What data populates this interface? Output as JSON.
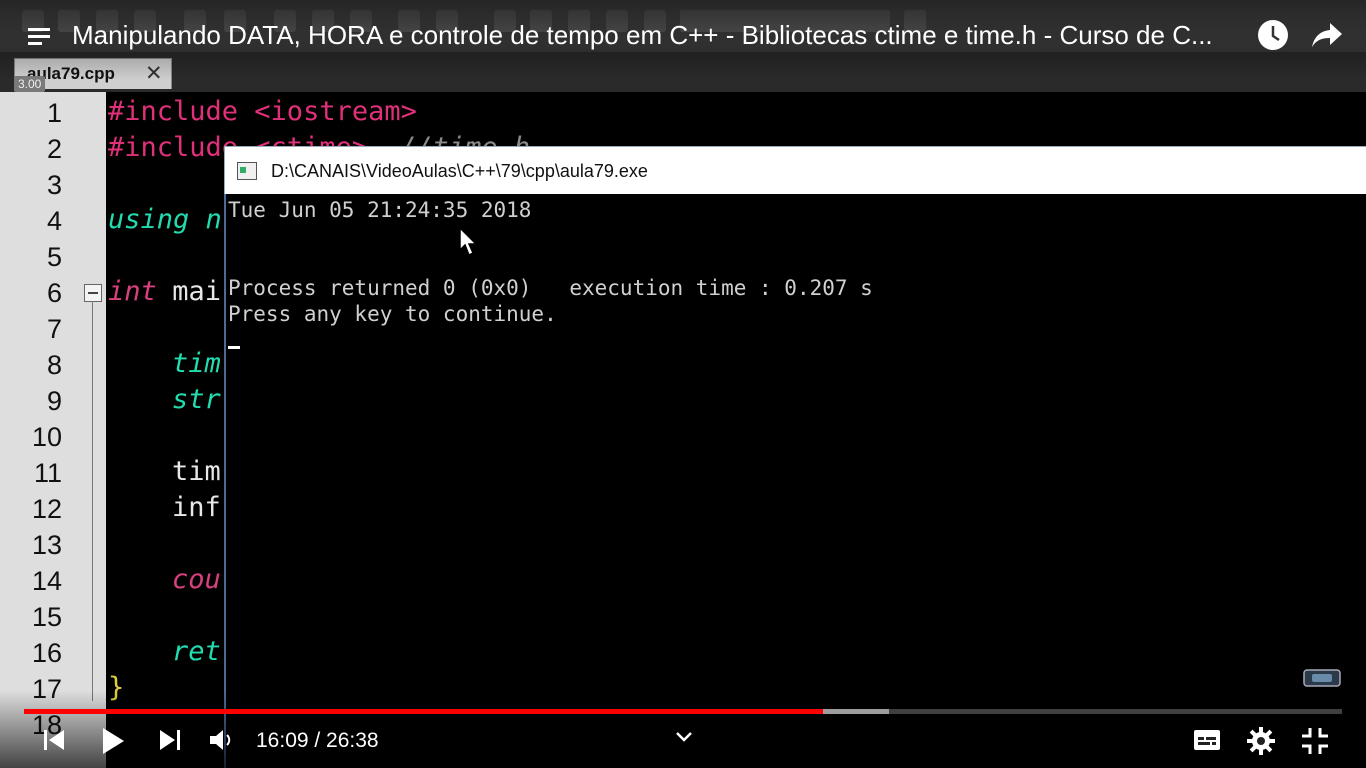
{
  "window_title": "Manipulando DATA, HORA e controle de tempo em C++ - Bibliotecas ctime e time.h - Curso de C...",
  "playback_speed": "3.00",
  "editor": {
    "tab_label": "aula79.cpp",
    "tab_close": "✕",
    "line_numbers": [
      "1",
      "2",
      "3",
      "4",
      "5",
      "6",
      "7",
      "8",
      "9",
      "10",
      "11",
      "12",
      "13",
      "14",
      "15",
      "16",
      "17",
      "18"
    ],
    "lines": {
      "l1": "#include <iostream>",
      "l2a": "#include <ctime>",
      "l2b": "//time.h",
      "l4a": "using n",
      "l6a": "int",
      "l6b": " mai",
      "l8": "tim",
      "l9": "str",
      "l11": "tim",
      "l12": "inf",
      "l14": "cou",
      "l16": "ret",
      "l17": "}"
    }
  },
  "console": {
    "title": "D:\\CANAIS\\VideoAulas\\C++\\79\\cpp\\aula79.exe",
    "line1": "Tue Jun 05 21:24:35 2018",
    "line2": "Process returned 0 (0x0)   execution time : 0.207 s",
    "line3": "Press any key to continue."
  },
  "player": {
    "current_time": "16:09",
    "duration": "26:38",
    "time_display": "16:09 / 26:38",
    "progress_fraction": 0.606,
    "buffered_fraction": 0.656,
    "progress_color": "#ff0000"
  },
  "icons": {
    "menu": "menu-icon",
    "watch_later": "clock-icon",
    "share": "share-icon",
    "previous": "skip-previous-icon",
    "play": "play-icon",
    "next": "skip-next-icon",
    "volume": "volume-icon",
    "chevron": "chevron-down-icon",
    "subtitles": "subtitles-icon",
    "settings": "gear-icon",
    "fullscreen_exit": "fullscreen-exit-icon"
  }
}
